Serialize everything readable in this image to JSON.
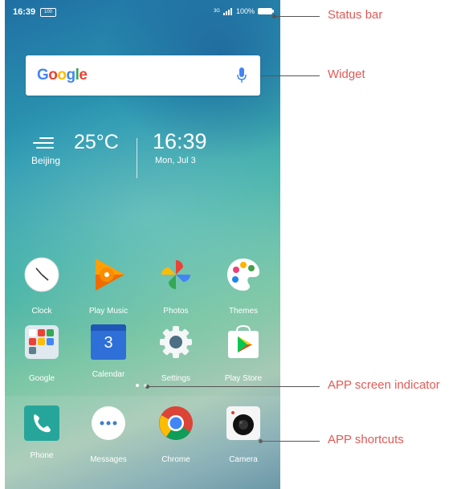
{
  "status_bar": {
    "time": "16:39",
    "chip": "100",
    "network": "3G",
    "battery": "100%"
  },
  "search_widget": {
    "logo": [
      "G",
      "o",
      "o",
      "g",
      "l",
      "e"
    ],
    "logo_colors": [
      "#4285F4",
      "#EA4335",
      "#FBBC05",
      "#4285F4",
      "#34A853",
      "#EA4335"
    ],
    "mic_color": "#4285F4"
  },
  "weather": {
    "temperature": "25°C",
    "city": "Beijing",
    "time": "16:39",
    "date": "Mon, Jul 3"
  },
  "apps_row1": [
    {
      "label": "Clock",
      "icon": "clock-icon"
    },
    {
      "label": "Play Music",
      "icon": "play-music-icon"
    },
    {
      "label": "Photos",
      "icon": "photos-icon"
    },
    {
      "label": "Themes",
      "icon": "themes-icon"
    }
  ],
  "apps_row2": [
    {
      "label": "Google",
      "icon": "google-folder-icon"
    },
    {
      "label": "Calendar",
      "icon": "calendar-icon",
      "day": "3"
    },
    {
      "label": "Settings",
      "icon": "settings-icon"
    },
    {
      "label": "Play Store",
      "icon": "play-store-icon"
    }
  ],
  "dock": [
    {
      "label": "Phone",
      "icon": "phone-icon"
    },
    {
      "label": "Messages",
      "icon": "messages-icon"
    },
    {
      "label": "Chrome",
      "icon": "chrome-icon"
    },
    {
      "label": "Camera",
      "icon": "camera-icon"
    }
  ],
  "page_indicator": {
    "pages": 2,
    "current": 1
  },
  "annotations": {
    "status_bar": "Status bar",
    "widget": "Widget",
    "screen_indicator": "APP screen indicator",
    "shortcuts": "APP shortcuts"
  },
  "colors": {
    "annotation": "#e05a56",
    "leader": "#555555"
  }
}
